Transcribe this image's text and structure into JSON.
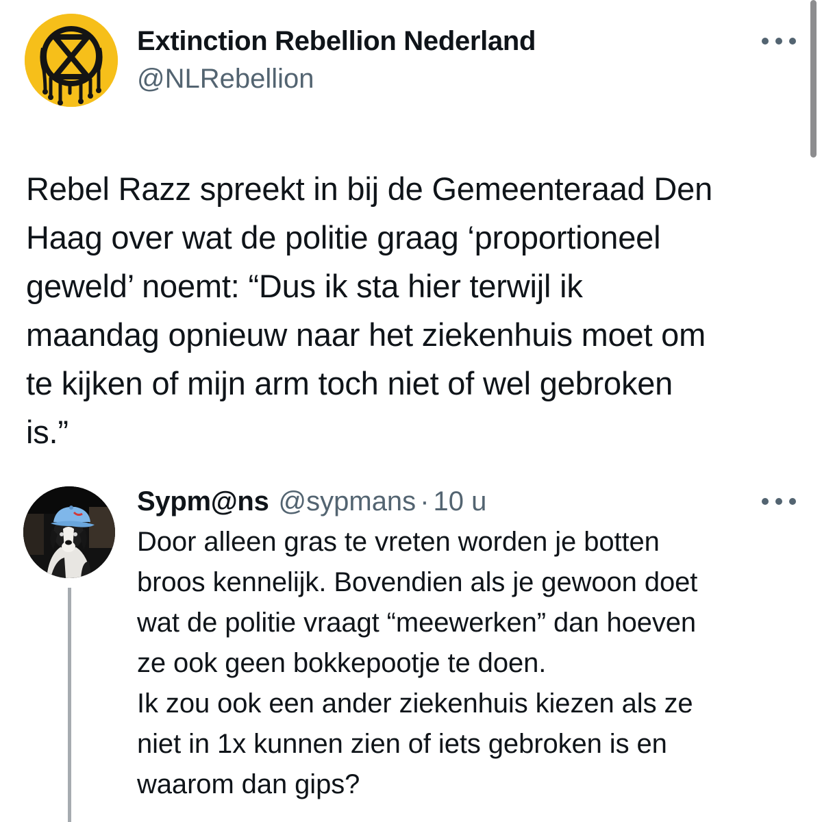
{
  "main_tweet": {
    "display_name": "Extinction Rebellion Nederland",
    "handle": "@NLRebellion",
    "text": "Rebel Razz spreekt in bij de Gemeenteraad Den Haag over wat de politie graag ‘proportioneel geweld’ noemt: “Dus ik sta hier terwijl ik maandag opnieuw naar het ziekenhuis moet om te kijken of mijn arm toch niet of wel gebroken is.”",
    "lines": [
      "Rebel Razz spreekt in bij de Gemeenteraad Den",
      "Haag over wat de politie graag ‘proportioneel",
      "geweld’ noemt: “Dus ik sta hier terwijl ik",
      "maandag opnieuw naar het ziekenhuis moet om",
      "te kijken of mijn arm toch niet of wel gebroken",
      "is.”"
    ],
    "avatar_icon": "extinction-symbol-icon",
    "more_icon": "more-options-icon"
  },
  "reply": {
    "display_name": "Sypm@ns",
    "handle": "@sypmans",
    "separator": "·",
    "time": "10 u",
    "avatar_icon": "dog-with-cap-avatar",
    "more_icon": "more-options-icon",
    "lines": [
      "Door alleen gras te vreten worden je botten",
      "broos kennelijk. Bovendien als je gewoon doet",
      "wat de politie vraagt “meewerken” dan hoeven",
      "ze ook geen bokkepootje te doen.",
      "Ik zou ook een ander ziekenhuis kiezen als ze",
      "niet in 1x kunnen zien of iets gebroken is en",
      "waarom dan gips?"
    ]
  },
  "colors": {
    "text": "#0f1419",
    "secondary": "#536471",
    "xr_yellow": "#f6bf1a",
    "thread_line": "#a6abb0"
  }
}
